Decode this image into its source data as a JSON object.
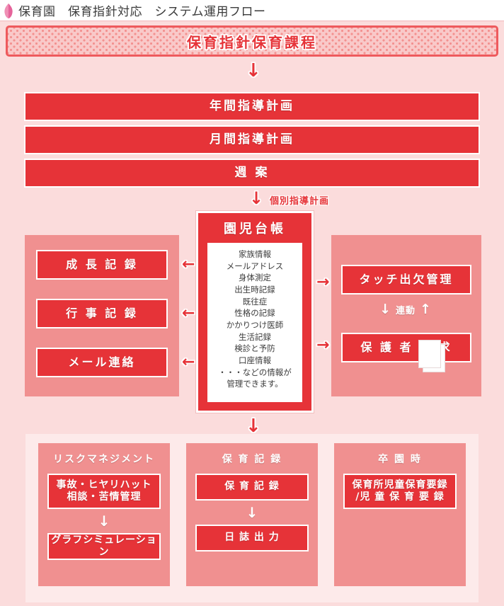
{
  "header": {
    "icon": "petal-icon",
    "title": "保育園　保育指針対応　システム運用フロー"
  },
  "banner": {
    "title": "保育指針保育課程"
  },
  "plans": [
    {
      "label": "年間指導計画"
    },
    {
      "label": "月間指導計画"
    },
    {
      "label": "週 案"
    }
  ],
  "arrows": {
    "down": "↓",
    "left": "←",
    "right": "→",
    "up": "↑",
    "kobetsu_label": "個別指導計画",
    "rendou_label": "連動"
  },
  "ledger": {
    "title": "園児台帳",
    "items": [
      "家族情報",
      "メールアドレス",
      "身体測定",
      "出生時記録",
      "既往症",
      "性格の記録",
      "かかりつけ医師",
      "生活記録",
      "検診と予防",
      "口座情報",
      "・・・などの情報が",
      "管理できます。"
    ]
  },
  "left_panel": {
    "boxes": [
      {
        "label": "成 長 記 録"
      },
      {
        "label": "行 事 記 録"
      },
      {
        "label": "メール連絡"
      }
    ]
  },
  "right_panel": {
    "boxes": [
      {
        "label": "タッチ出欠管理"
      },
      {
        "label": "保 護 者 請 求"
      }
    ]
  },
  "bottom_panels": [
    {
      "title": "リスクマネジメント",
      "box1": "事故・ヒヤリハット\n相談・苦情管理",
      "box1_line1": "事故・ヒヤリハット",
      "box1_line2": "相談・苦情管理",
      "box2": "グラフシミュレーション"
    },
    {
      "title": "保 育 記 録",
      "box1_line1": "保 育 記 録",
      "box2": "日 誌 出 力"
    },
    {
      "title": "卒 園 時",
      "box1_line1": "保育所児童保育要録",
      "box1_line2": "/児 童 保 育 要 録"
    }
  ],
  "colors": {
    "red": "#e63338",
    "banner_border": "#ee5a5d",
    "panel_pink": "#f09090",
    "canvas_pink": "#fbdcdc",
    "bottom_container": "#fdeaea"
  }
}
